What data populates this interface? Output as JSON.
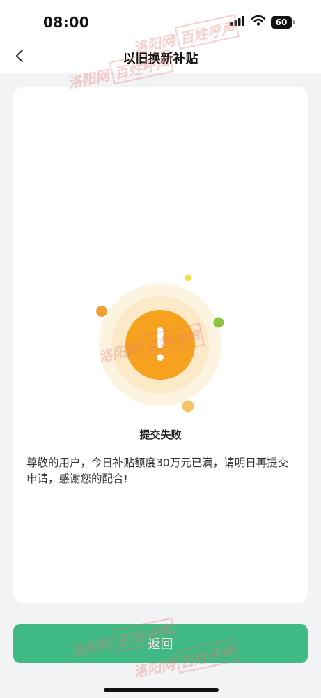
{
  "status_bar": {
    "time": "08:00",
    "battery": "60",
    "signal_icon": "signal-bars-icon",
    "wifi_icon": "wifi-icon"
  },
  "nav": {
    "title": "以旧换新补贴",
    "back_icon": "chevron-left-icon"
  },
  "result": {
    "icon": "warning-exclamation-icon",
    "title": "提交失败",
    "message": "尊敬的用户，今日补贴额度30万元已满，请明日再提交申请，感谢您的配合!"
  },
  "footer": {
    "return_label": "返回"
  },
  "watermark": {
    "left_text": "洛阳网",
    "boxed_text": "百姓呼声"
  },
  "colors": {
    "primary_green": "#3fba84",
    "warning_orange": "#f6a21e",
    "page_background": "#f2f3f5"
  }
}
